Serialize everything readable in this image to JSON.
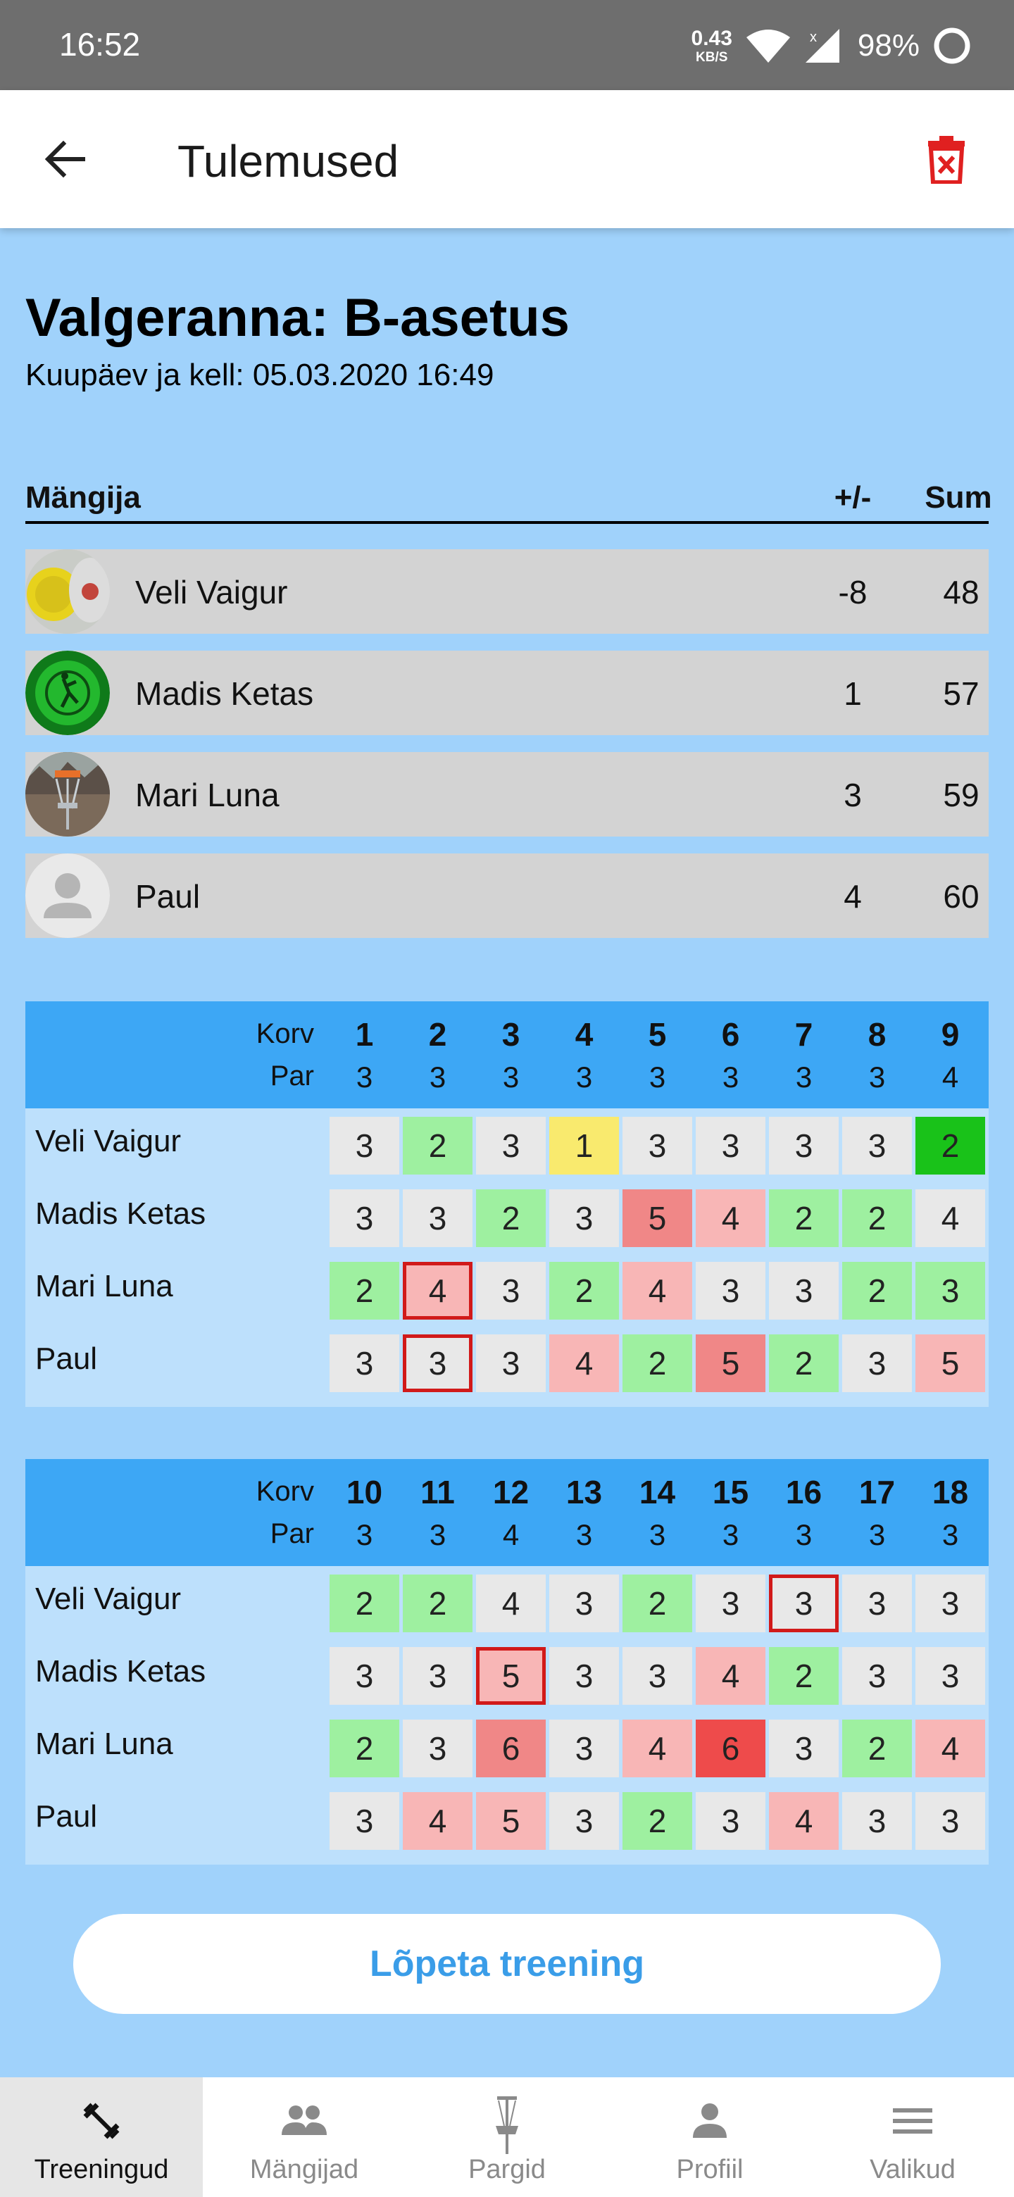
{
  "status_bar": {
    "time": "16:52",
    "net_speed_value": "0.43",
    "net_speed_unit": "KB/S",
    "battery": "98%"
  },
  "app_bar": {
    "title": "Tulemused",
    "back_icon": "arrow-left-icon",
    "delete_icon": "trash-icon"
  },
  "course": {
    "title": "Valgeranna: B-asetus",
    "datetime": "Kuupäev ja kell: 05.03.2020 16:49"
  },
  "players_header": {
    "player": "Mängija",
    "diff": "+/-",
    "sum": "Sum"
  },
  "players": [
    {
      "name": "Veli Vaigur",
      "diff": "-8",
      "sum": "48"
    },
    {
      "name": "Madis Ketas",
      "diff": "1",
      "sum": "57"
    },
    {
      "name": "Mari Luna",
      "diff": "3",
      "sum": "59"
    },
    {
      "name": "Paul",
      "diff": "4",
      "sum": "60"
    }
  ],
  "table_labels": {
    "korv": "Korv",
    "par": "Par"
  },
  "front_nine": {
    "holes": [
      "1",
      "2",
      "3",
      "4",
      "5",
      "6",
      "7",
      "8",
      "9"
    ],
    "pars": [
      "3",
      "3",
      "3",
      "3",
      "3",
      "3",
      "3",
      "3",
      "4"
    ],
    "rows": [
      {
        "name": "Veli Vaigur",
        "scores": [
          "3",
          "2",
          "3",
          "1",
          "3",
          "3",
          "3",
          "3",
          "2"
        ]
      },
      {
        "name": "Madis Ketas",
        "scores": [
          "3",
          "3",
          "2",
          "3",
          "5",
          "4",
          "2",
          "2",
          "4"
        ]
      },
      {
        "name": "Mari Luna",
        "scores": [
          "2",
          "4",
          "3",
          "2",
          "4",
          "3",
          "3",
          "2",
          "3"
        ]
      },
      {
        "name": "Paul",
        "scores": [
          "3",
          "3",
          "3",
          "4",
          "2",
          "5",
          "2",
          "3",
          "5"
        ]
      }
    ]
  },
  "back_nine": {
    "holes": [
      "10",
      "11",
      "12",
      "13",
      "14",
      "15",
      "16",
      "17",
      "18"
    ],
    "pars": [
      "3",
      "3",
      "4",
      "3",
      "3",
      "3",
      "3",
      "3",
      "3"
    ],
    "rows": [
      {
        "name": "Veli Vaigur",
        "scores": [
          "2",
          "2",
          "4",
          "3",
          "2",
          "3",
          "3",
          "3",
          "3"
        ]
      },
      {
        "name": "Madis Ketas",
        "scores": [
          "3",
          "3",
          "5",
          "3",
          "3",
          "4",
          "2",
          "3",
          "3"
        ]
      },
      {
        "name": "Mari Luna",
        "scores": [
          "2",
          "3",
          "6",
          "3",
          "4",
          "6",
          "3",
          "2",
          "4"
        ]
      },
      {
        "name": "Paul",
        "scores": [
          "3",
          "4",
          "5",
          "3",
          "2",
          "3",
          "4",
          "3",
          "3"
        ]
      }
    ]
  },
  "score_colors": {
    "ace": "#f9ea6e",
    "eagle": "#19c219",
    "birdie": "#9ef0a0",
    "par": "#e8e8e8",
    "bogey": "#f8b6b6",
    "double_bogey": "#f08787",
    "triple_bogey": "#ee4b4b",
    "highlight_border": "#d11a1a"
  },
  "finish_button": "Lõpeta treening",
  "bottom_nav": [
    {
      "label": "Treeningud",
      "icon": "dumbbell-icon",
      "active": true
    },
    {
      "label": "Mängijad",
      "icon": "people-icon",
      "active": false
    },
    {
      "label": "Pargid",
      "icon": "disc-golf-basket-icon",
      "active": false
    },
    {
      "label": "Profiil",
      "icon": "person-icon",
      "active": false
    },
    {
      "label": "Valikud",
      "icon": "menu-icon",
      "active": false
    }
  ]
}
